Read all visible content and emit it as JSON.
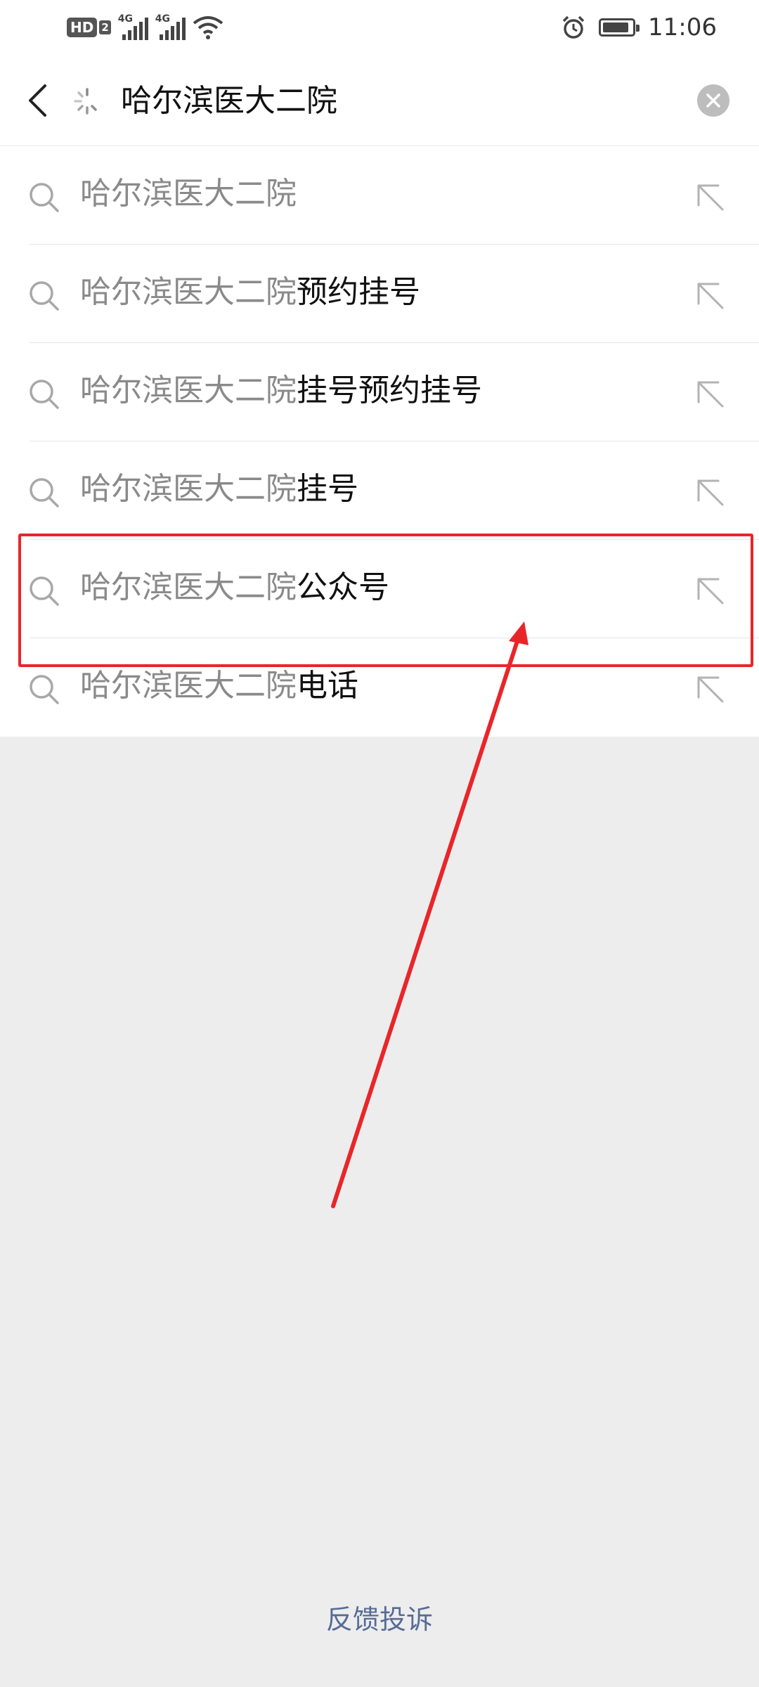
{
  "status_bar": {
    "hd_label": "HD",
    "hd_num": "2",
    "signal_1_label": "4G",
    "signal_2_label": "4G",
    "time": "11:06",
    "icons": [
      "hd-icon",
      "signal-icon",
      "wifi-icon",
      "alarm-icon",
      "battery-icon"
    ],
    "battery_level": 0.9
  },
  "search": {
    "query": "哈尔滨医大二院",
    "back_icon": "chevron-left-icon",
    "loading_icon": "spinner-icon",
    "clear_icon": "close-circle-icon"
  },
  "suggestions": [
    {
      "prefix": "哈尔滨医大二院",
      "suffix": ""
    },
    {
      "prefix": "哈尔滨医大二院",
      "suffix": "预约挂号"
    },
    {
      "prefix": "哈尔滨医大二院",
      "suffix": "挂号预约挂号"
    },
    {
      "prefix": "哈尔滨医大二院",
      "suffix": "挂号"
    },
    {
      "prefix": "哈尔滨医大二院",
      "suffix": "公众号"
    },
    {
      "prefix": "哈尔滨医大二院",
      "suffix": "电话"
    }
  ],
  "annotation": {
    "highlight_color": "#e8262a",
    "highlighted_index": 4
  },
  "footer": {
    "feedback_label": "反馈投诉",
    "link_color": "#576b95"
  }
}
